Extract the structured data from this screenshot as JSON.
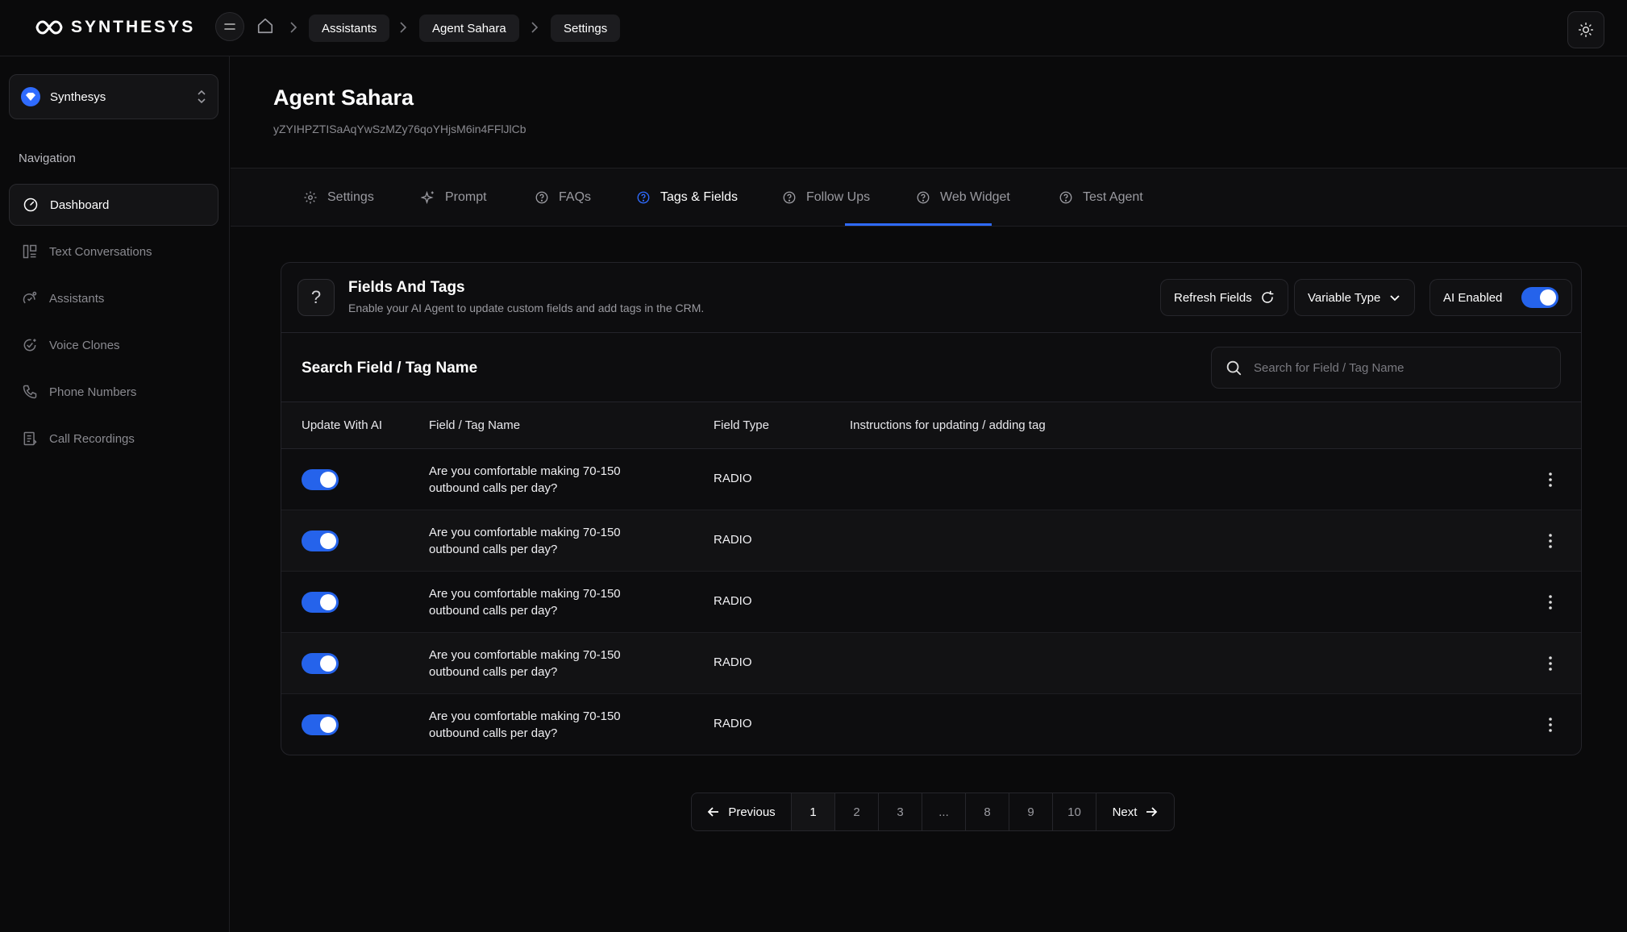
{
  "app": {
    "logo_text": "SYNTHESYS"
  },
  "breadcrumb": [
    "Assistants",
    "Agent Sahara",
    "Settings"
  ],
  "sidebar": {
    "workspace": "Synthesys",
    "nav_title": "Navigation",
    "items": [
      {
        "label": "Dashboard",
        "icon": "dashboard-icon",
        "active": true
      },
      {
        "label": "Text Conversations",
        "icon": "conversations-icon"
      },
      {
        "label": "Assistants",
        "icon": "assistants-icon"
      },
      {
        "label": "Voice Clones",
        "icon": "voice-clones-icon"
      },
      {
        "label": "Phone Numbers",
        "icon": "phone-icon"
      },
      {
        "label": "Call Recordings",
        "icon": "recordings-icon"
      }
    ]
  },
  "agent": {
    "title": "Agent Sahara",
    "id": "yZYIHPZTISaAqYwSzMZy76qoYHjsM6in4FFlJlCb"
  },
  "tabs": [
    {
      "label": "Settings",
      "icon": "gear-icon"
    },
    {
      "label": "Prompt",
      "icon": "sparkle-icon"
    },
    {
      "label": "FAQs",
      "icon": "help-circle-icon"
    },
    {
      "label": "Tags & Fields",
      "icon": "help-circle-icon",
      "active": true
    },
    {
      "label": "Follow Ups",
      "icon": "help-circle-icon"
    },
    {
      "label": "Web Widget",
      "icon": "help-circle-icon"
    },
    {
      "label": "Test Agent",
      "icon": "help-circle-icon"
    }
  ],
  "card": {
    "icon_glyph": "?",
    "title": "Fields And Tags",
    "subtitle": "Enable your AI Agent to update custom fields and add tags in the CRM.",
    "refresh_label": "Refresh Fields",
    "variable_type_label": "Variable Type",
    "ai_enabled_label": "AI Enabled",
    "ai_enabled": true
  },
  "search": {
    "title": "Search Field / Tag Name",
    "placeholder": "Search for Field / Tag Name",
    "value": ""
  },
  "table": {
    "columns": [
      "Update With AI",
      "Field / Tag Name",
      "Field Type",
      "Instructions for updating / adding tag"
    ],
    "rows": [
      {
        "enabled": true,
        "name": "Are you comfortable making 70-150 outbound calls per day?",
        "type": "RADIO",
        "instructions": ""
      },
      {
        "enabled": true,
        "name": "Are you comfortable making 70-150 outbound calls per day?",
        "type": "RADIO",
        "instructions": ""
      },
      {
        "enabled": true,
        "name": "Are you comfortable making 70-150 outbound calls per day?",
        "type": "RADIO",
        "instructions": ""
      },
      {
        "enabled": true,
        "name": "Are you comfortable making 70-150 outbound calls per day?",
        "type": "RADIO",
        "instructions": ""
      },
      {
        "enabled": true,
        "name": "Are you comfortable making 70-150 outbound calls per day?",
        "type": "RADIO",
        "instructions": ""
      }
    ]
  },
  "pagination": {
    "previous_label": "Previous",
    "next_label": "Next",
    "pages": [
      "1",
      "2",
      "3",
      "...",
      "8",
      "9",
      "10"
    ],
    "current": "1"
  },
  "colors": {
    "accent": "#2563eb",
    "background": "#0a0a0b"
  }
}
